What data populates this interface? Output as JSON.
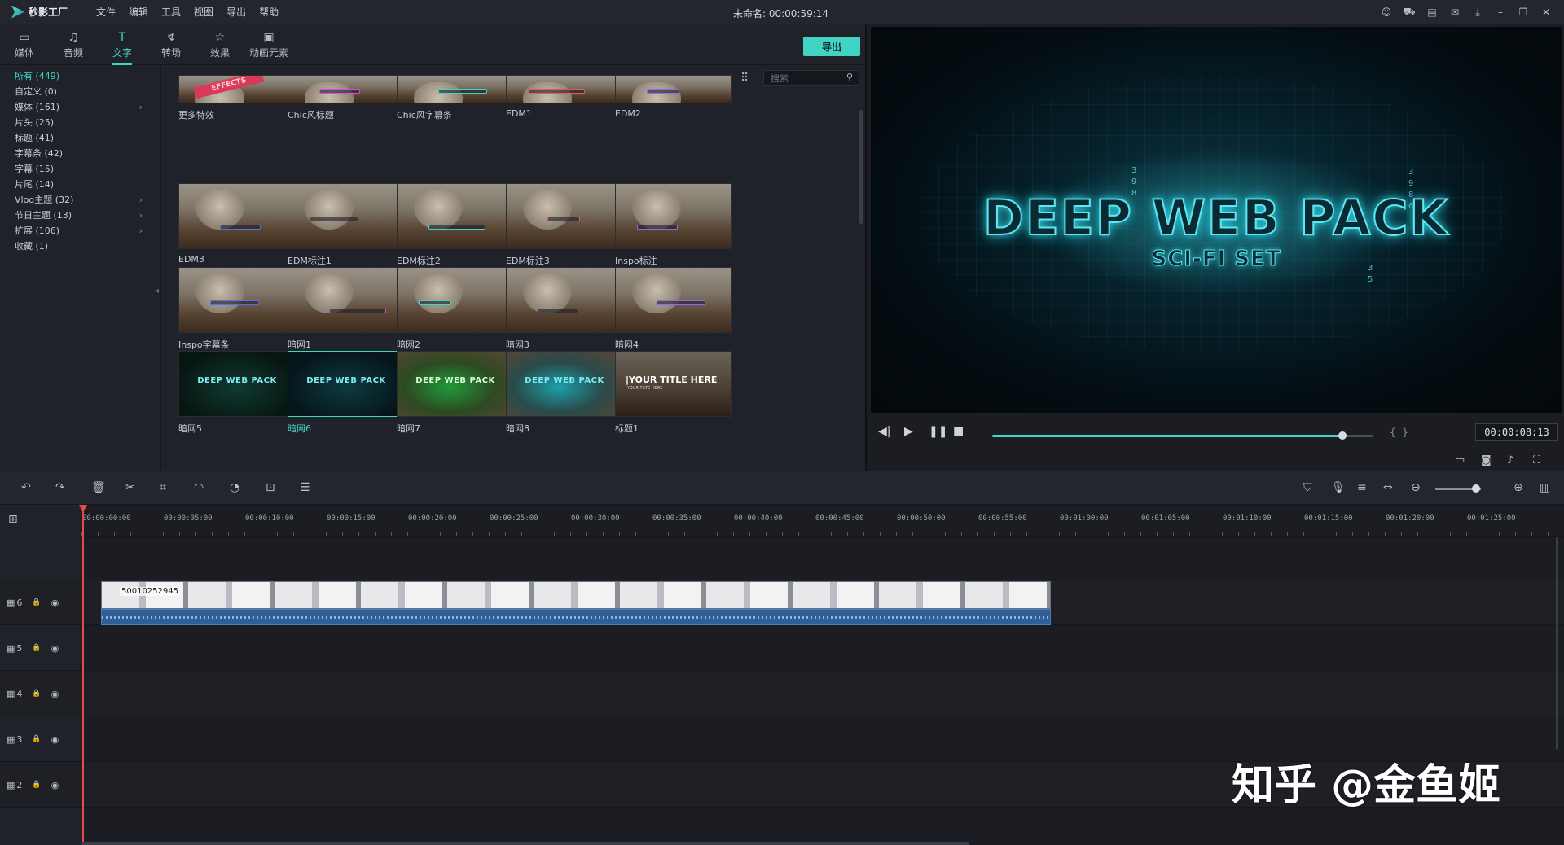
{
  "app": {
    "logo_text": "秒影工厂",
    "doc_title": "未命名: 00:00:59:14"
  },
  "menu": [
    "文件",
    "编辑",
    "工具",
    "视图",
    "导出",
    "帮助"
  ],
  "tabs": [
    {
      "label": "媒体",
      "icon": "folder-icon",
      "glyph": "▭"
    },
    {
      "label": "音频",
      "icon": "music-note-icon",
      "glyph": "♫"
    },
    {
      "label": "文字",
      "icon": "text-icon",
      "glyph": "T"
    },
    {
      "label": "转场",
      "icon": "transition-icon",
      "glyph": "↯"
    },
    {
      "label": "效果",
      "icon": "effects-icon",
      "glyph": "☆"
    },
    {
      "label": "动画元素",
      "icon": "image-icon",
      "glyph": "▣"
    }
  ],
  "export_label": "导出",
  "categories": [
    {
      "label": "所有 (449)",
      "active": true,
      "chevron": false
    },
    {
      "label": "自定义 (0)",
      "active": false,
      "chevron": false
    },
    {
      "label": "媒体 (161)",
      "active": false,
      "chevron": true
    },
    {
      "label": "片头 (25)",
      "active": false,
      "chevron": false
    },
    {
      "label": "标题 (41)",
      "active": false,
      "chevron": false
    },
    {
      "label": "字幕条 (42)",
      "active": false,
      "chevron": false
    },
    {
      "label": "字幕 (15)",
      "active": false,
      "chevron": false
    },
    {
      "label": "片尾 (14)",
      "active": false,
      "chevron": false
    },
    {
      "label": "Vlog主题 (32)",
      "active": false,
      "chevron": true
    },
    {
      "label": "节日主题 (13)",
      "active": false,
      "chevron": true
    },
    {
      "label": "扩展 (106)",
      "active": false,
      "chevron": true
    },
    {
      "label": "收藏 (1)",
      "active": false,
      "chevron": false
    }
  ],
  "search": {
    "placeholder": "搜索"
  },
  "thumbnails": [
    {
      "label": "更多特效",
      "style": "photo",
      "banner": "EFFECTS"
    },
    {
      "label": "Chic风标题",
      "style": "photo"
    },
    {
      "label": "Chic风字幕条",
      "style": "photo"
    },
    {
      "label": "EDM1",
      "style": "photo"
    },
    {
      "label": "EDM2",
      "style": "photo"
    },
    {
      "label": "EDM3",
      "style": "photo"
    },
    {
      "label": "EDM标注1",
      "style": "photo"
    },
    {
      "label": "EDM标注2",
      "style": "photo"
    },
    {
      "label": "EDM标注3",
      "style": "photo"
    },
    {
      "label": "Inspo标注",
      "style": "photo"
    },
    {
      "label": "Inspo字幕条",
      "style": "photo"
    },
    {
      "label": "暗网1",
      "style": "photo"
    },
    {
      "label": "暗网2",
      "style": "photo"
    },
    {
      "label": "暗网3",
      "style": "photo"
    },
    {
      "label": "暗网4",
      "style": "photo"
    },
    {
      "label": "暗网5",
      "style": "dark",
      "overlay": "DEEP WEB PACK"
    },
    {
      "label": "暗网6",
      "style": "dark2",
      "overlay": "DEEP WEB PACK",
      "selected": true
    },
    {
      "label": "暗网7",
      "style": "green",
      "overlay": "DEEP WEB PACK"
    },
    {
      "label": "暗网8",
      "style": "cyan",
      "overlay": "DEEP WEB PACK"
    },
    {
      "label": "标题1",
      "style": "titled",
      "title": "|YOUR TITLE HERE",
      "subtitle": "YOUR TILTE HERE"
    }
  ],
  "preview": {
    "title": "DEEP WEB PACK",
    "subtitle": "SCI-FI SET",
    "timecode": "00:00:08:13",
    "progress": 0.94
  },
  "timeline": {
    "ticks": [
      "00:00:00:00",
      "00:00:05:00",
      "00:00:10:00",
      "00:00:15:00",
      "00:00:20:00",
      "00:00:25:00",
      "00:00:30:00",
      "00:00:35:00",
      "00:00:40:00",
      "00:00:45:00",
      "00:00:50:00",
      "00:00:55:00",
      "00:01:00:00",
      "00:01:05:00",
      "00:01:10:00",
      "00:01:15:00",
      "00:01:20:00",
      "00:01:25:00"
    ],
    "tracks": [
      "6",
      "5",
      "4",
      "3",
      "2"
    ],
    "clip_label": "50010252945"
  },
  "watermark": "知乎 @金鱼姬",
  "colors": {
    "accent": "#41d3c3",
    "playhead": "#e84a4a"
  }
}
